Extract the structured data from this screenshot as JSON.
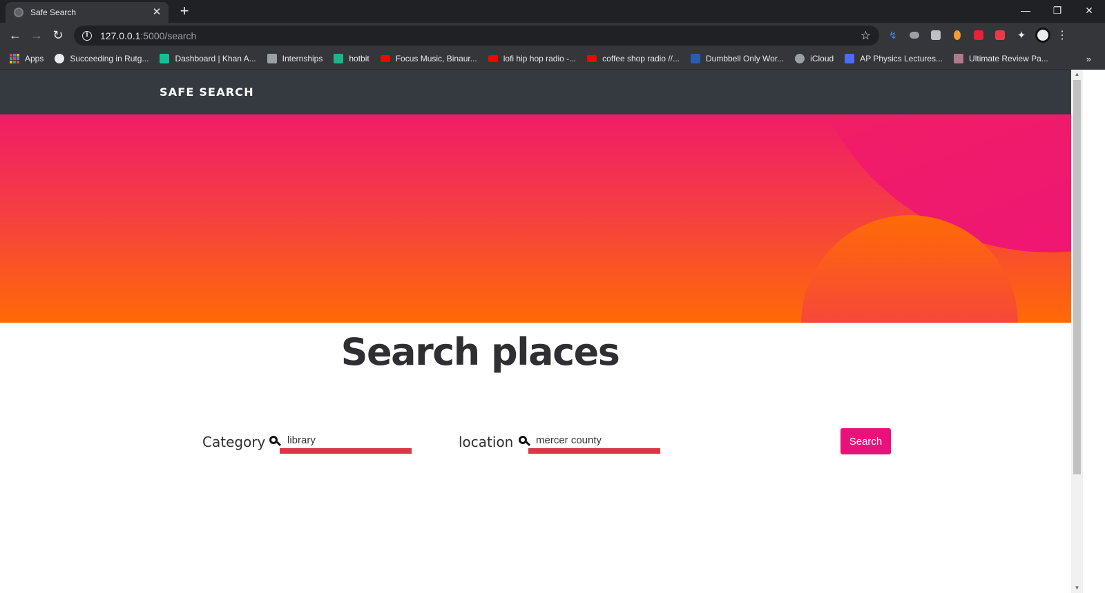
{
  "browser": {
    "tab_title": "Safe Search",
    "url_host": "127.0.0.1",
    "url_rest": ":5000/search",
    "bookmarks": [
      {
        "label": "Apps",
        "icon": "apps-grid-icon",
        "color": "#ea4335"
      },
      {
        "label": "Succeeding in Rutg...",
        "icon": "globe-icon",
        "color": "#e8eaed"
      },
      {
        "label": "Dashboard | Khan A...",
        "icon": "khan-academy-icon",
        "color": "#14bf96"
      },
      {
        "label": "Internships",
        "icon": "chart-icon",
        "color": "#9aa0a6"
      },
      {
        "label": "hotbit",
        "icon": "hotbit-icon",
        "color": "#1fb48a"
      },
      {
        "label": "Focus Music, Binaur...",
        "icon": "youtube-icon",
        "color": "#ff0000"
      },
      {
        "label": "lofi hip hop radio -...",
        "icon": "youtube-icon",
        "color": "#ff0000"
      },
      {
        "label": "coffee shop radio //...",
        "icon": "youtube-icon",
        "color": "#ff0000"
      },
      {
        "label": "Dumbbell Only Wor...",
        "icon": "dumbbell-icon",
        "color": "#2a5db0"
      },
      {
        "label": "iCloud",
        "icon": "apple-icon",
        "color": "#9aa0a6"
      },
      {
        "label": "AP Physics Lectures...",
        "icon": "calendar-icon",
        "color": "#4a6cf7"
      },
      {
        "label": "Ultimate Review Pa...",
        "icon": "profile-photo-icon",
        "color": "#b07a8c"
      }
    ]
  },
  "site": {
    "brand": "SAFE SEARCH",
    "title": "Search places",
    "category_label": "Category",
    "category_value": "library",
    "location_label": "location",
    "location_value": "mercer county",
    "search_button": "Search"
  },
  "colors": {
    "navbar": "#343a40",
    "hero_top": "#f01c68",
    "hero_bottom": "#ff6a06",
    "accent": "#e9117a",
    "underline": "#dc3545"
  }
}
